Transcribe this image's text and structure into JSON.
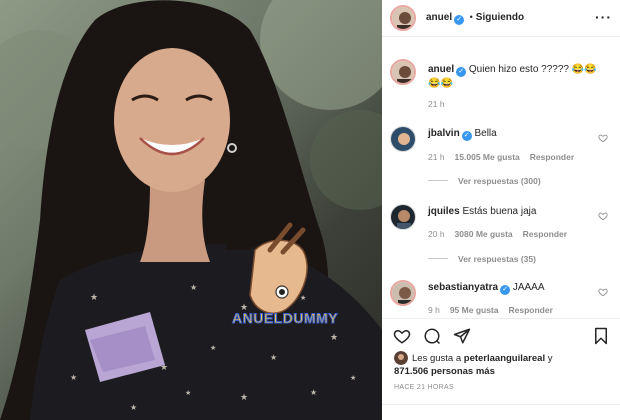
{
  "header": {
    "username": "anuel",
    "separator": "•",
    "follow_status": "Siguiendo"
  },
  "caption": {
    "username": "anuel",
    "text": "Quien hizo esto ?????",
    "emoji": "😂😂😂😂",
    "time": "21 h"
  },
  "comments": [
    {
      "username": "jbalvin",
      "text": "Bella",
      "time": "21 h",
      "likes": "15.005 Me gusta",
      "reply": "Responder",
      "view_replies": "Ver respuestas (300)"
    },
    {
      "username": "jquiles",
      "text": "Estás buena jaja",
      "time": "20 h",
      "likes": "3080 Me gusta",
      "reply": "Responder",
      "view_replies": "Ver respuestas (35)"
    },
    {
      "username": "sebastianyatra",
      "text": "JAAAA",
      "time": "9 h",
      "likes": "95 Me gusta",
      "reply": "Responder"
    }
  ],
  "post": {
    "liked_by_prefix": "Les gusta a",
    "liked_by_user": "peterlaanguilareal",
    "liked_by_suffix": "y",
    "likes_count": "871.506 personas más",
    "time_ago": "HACE 21 HORAS"
  },
  "photo": {
    "watermark": "ANUELDUMMY"
  },
  "colors": {
    "verified": "#3897f0",
    "muted": "#8e8e8e",
    "text": "#262626"
  },
  "icons": [
    "more-options-icon",
    "verified-badge-icon",
    "heart-icon",
    "comment-icon",
    "share-icon",
    "bookmark-icon"
  ]
}
